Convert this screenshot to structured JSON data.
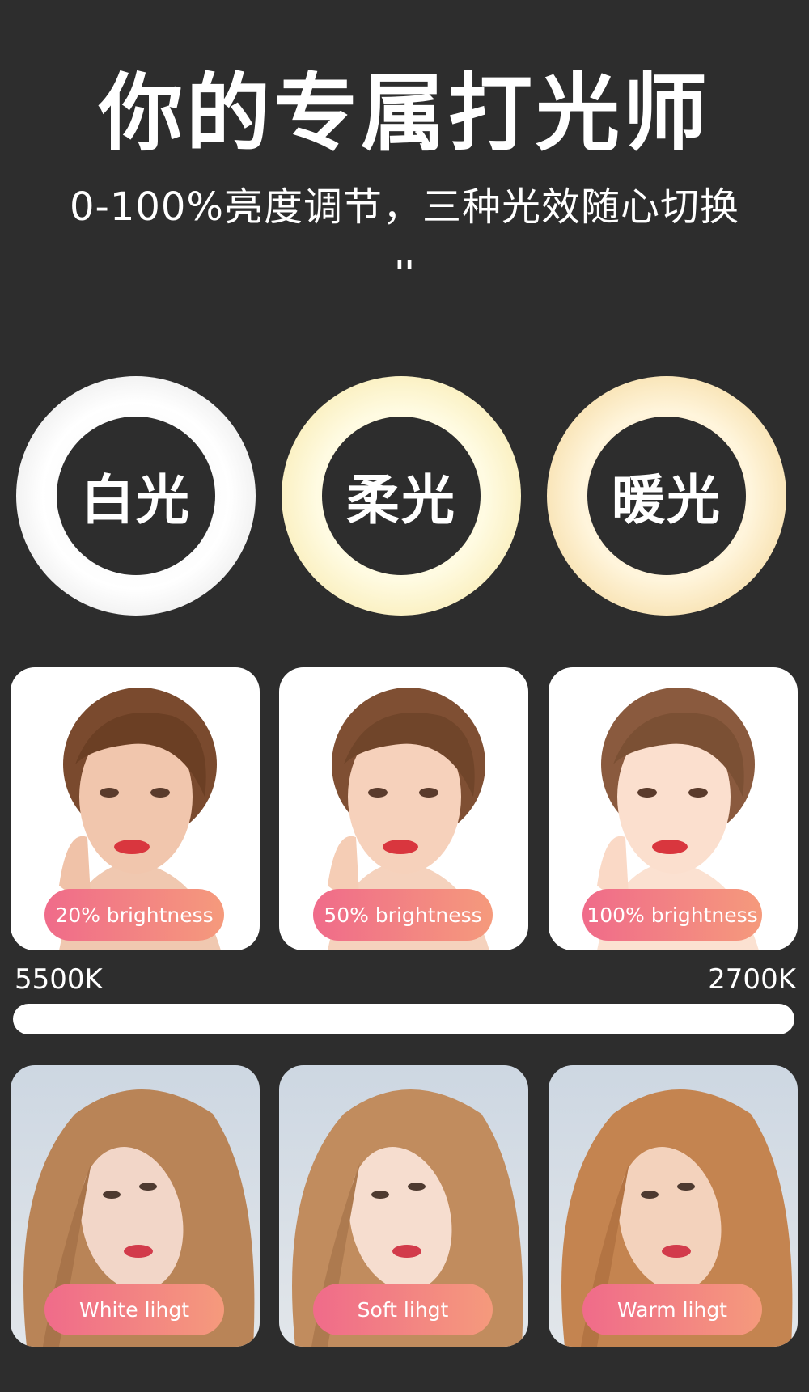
{
  "header": {
    "title": "你的专属打光师",
    "subtitle": "0-100%亮度调节，三种光效随心切换",
    "quote_mark": "''"
  },
  "rings": [
    {
      "label": "白光",
      "color": "#f2f2f2"
    },
    {
      "label": "柔光",
      "color": "#fff7c6"
    },
    {
      "label": "暖光",
      "color": "#fde3a6"
    }
  ],
  "brightness_cards": [
    {
      "label": "20% brightness"
    },
    {
      "label": "50% brightness"
    },
    {
      "label": "100% brightness"
    }
  ],
  "color_temperature": {
    "left": "5500K",
    "right": "2700K"
  },
  "light_cards": [
    {
      "label": "White lihgt"
    },
    {
      "label": "Soft lihgt"
    },
    {
      "label": "Warm lihgt"
    }
  ],
  "colors": {
    "background": "#2d2d2d",
    "pill_start": "#f06b8a",
    "pill_end": "#f59a7c"
  }
}
